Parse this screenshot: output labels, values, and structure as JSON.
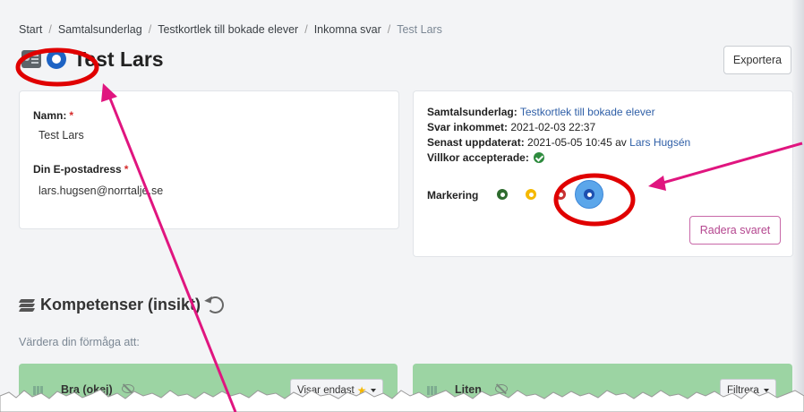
{
  "breadcrumb": {
    "items": [
      "Start",
      "Samtalsunderlag",
      "Testkortlek till bokade elever",
      "Inkomna svar"
    ],
    "current": "Test Lars",
    "separator": "/"
  },
  "page": {
    "title": "Test Lars"
  },
  "toolbar": {
    "export_label": "Exportera"
  },
  "form": {
    "name_label": "Namn:",
    "name_value": "Test Lars",
    "email_label": "Din E-postadress",
    "email_value": "lars.hugsen@norrtalje.se",
    "required_mark": "*"
  },
  "info": {
    "underlag_label": "Samtalsunderlag:",
    "underlag_value": "Testkortlek till bokade elever",
    "received_label": "Svar inkommet:",
    "received_value": "2021-02-03 22:37",
    "updated_label": "Senast uppdaterat:",
    "updated_value": "2021-05-05 10:45",
    "updated_by_prefix": "av",
    "updated_by": "Lars Hugsén",
    "terms_label": "Villkor accepterade:",
    "marking_label": "Markering",
    "delete_label": "Radera svaret",
    "marking_colors": {
      "green": "#2e6b2e",
      "yellow": "#f5b800",
      "red": "#c73232",
      "blue": "#1d4fb0"
    }
  },
  "section": {
    "title": "Kompetenser (insikt)",
    "subtitle": "Värdera din förmåga att:"
  },
  "groups": [
    {
      "name": "Bra (okej)",
      "button_label": "Visar endast"
    },
    {
      "name": "Liten",
      "button_label": "Filtrera"
    }
  ],
  "colors": {
    "annotation": "#e0157f",
    "highlight": "#e00000",
    "group_bg": "#9cd4a3",
    "link": "#2f5fa7"
  }
}
